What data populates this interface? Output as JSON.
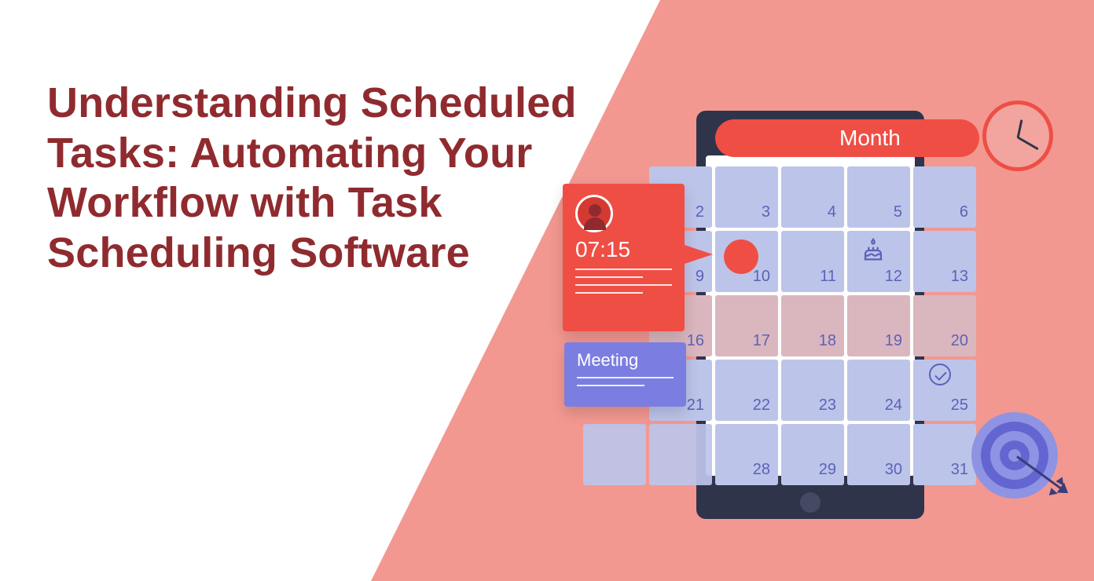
{
  "title": "Understanding Scheduled Tasks: Automating Your Workflow with Task Scheduling Software",
  "month_label": "Month",
  "event": {
    "time": "07:15"
  },
  "meeting": {
    "label": "Meeting"
  },
  "calendar": {
    "rows": [
      [
        "",
        "2",
        "3",
        "4",
        "5",
        "6",
        ""
      ],
      [
        "",
        "9",
        "10",
        "11",
        "12",
        "13",
        ""
      ],
      [
        "",
        "16",
        "17",
        "18",
        "19",
        "20",
        ""
      ],
      [
        "",
        "21",
        "22",
        "23",
        "24",
        "25",
        ""
      ],
      [
        "",
        "28",
        "29",
        "30",
        "31",
        "",
        ""
      ]
    ]
  },
  "icons": {
    "clock": "clock-icon",
    "avatar": "avatar-icon",
    "cake": "cake-icon",
    "check": "check-icon",
    "target": "target-icon",
    "arrow": "arrow-icon"
  },
  "colors": {
    "title": "#8f2b2f",
    "wedge": "#f29891",
    "accent_red": "#ef4e45",
    "accent_purple": "#7b7ee0",
    "cell": "#bdc4ea",
    "cell_alt": "#dab6bf",
    "tablet": "#2f344b"
  }
}
